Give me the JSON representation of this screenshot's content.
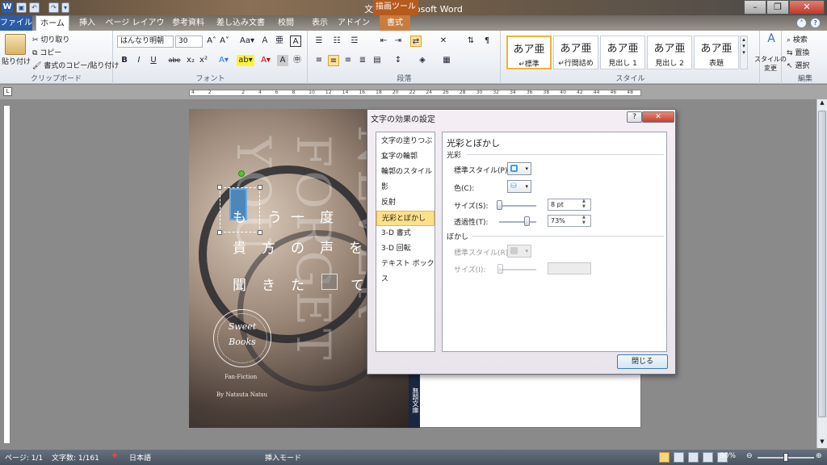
{
  "app": {
    "title": "文書1 - Microsoft Word",
    "context_tab": "描画ツール",
    "logo": "W"
  },
  "quick_access": [
    "save",
    "undo",
    "redo",
    "customize"
  ],
  "tabs": [
    {
      "label": "ファイル"
    },
    {
      "label": "ホーム"
    },
    {
      "label": "挿入"
    },
    {
      "label": "ページ レイアウト"
    },
    {
      "label": "参考資料"
    },
    {
      "label": "差し込み文書"
    },
    {
      "label": "校閲"
    },
    {
      "label": "表示"
    },
    {
      "label": "アドイン"
    },
    {
      "label": "書式"
    }
  ],
  "ribbon": {
    "clipboard": {
      "paste": "貼り付け",
      "cut": "切り取り",
      "copy": "コピー",
      "format_painter": "書式のコピー/貼り付け",
      "label": "クリップボード"
    },
    "font": {
      "name": "はんなり明朝",
      "size": "30",
      "label": "フォント",
      "buttons_row1": [
        "A˄",
        "A˅",
        "Aa▾",
        "Ａ",
        "亜",
        "A"
      ],
      "buttons_row2": [
        "B",
        "I",
        "U",
        "abe",
        "x₂",
        "x²",
        "A▾",
        "ab▾",
        "A▾",
        "A",
        "㊥"
      ]
    },
    "paragraph": {
      "label": "段落"
    },
    "styles": {
      "label": "スタイル",
      "items": [
        {
          "preview": "あア亜",
          "name": "↵標準"
        },
        {
          "preview": "あア亜",
          "name": "↵行間詰め"
        },
        {
          "preview": "あア亜",
          "name": "見出し 1"
        },
        {
          "preview": "あア亜",
          "name": "見出し 2"
        },
        {
          "preview": "あア亜",
          "name": "表題"
        }
      ],
      "change": "スタイルの 変更"
    },
    "editing": {
      "label": "編集",
      "find": "検索",
      "replace": "置換",
      "select": "選択"
    }
  },
  "ruler_numbers": [
    "4",
    "2",
    "",
    "2",
    "4",
    "6",
    "8",
    "10",
    "12",
    "14",
    "16",
    "18",
    "20",
    "22",
    "24",
    "26",
    "28",
    "30",
    "32",
    "34",
    "36",
    "38",
    "40",
    "42",
    "44",
    "46",
    "48"
  ],
  "document": {
    "cover_vertical_text": [
      "NEVER",
      "FORGET",
      "YOU"
    ],
    "line1": [
      "も",
      "う",
      "一",
      "度"
    ],
    "line2": [
      "貴",
      "方",
      "の",
      "声",
      "を"
    ],
    "line3": [
      "聞",
      "き",
      "た",
      "",
      "て"
    ],
    "seal_line1": "Sweet",
    "seal_line2": "Books",
    "fan_fiction": "Fan-Fiction",
    "author": "By Natsuta Natsu",
    "spine": "無題文庫"
  },
  "dialog": {
    "title": "文字の効果の設定",
    "help": "?",
    "close": "✕",
    "nav": [
      "文字の塗りつぶし",
      "文字の輪郭",
      "輪郭のスタイル",
      "影",
      "反射",
      "光彩とぼかし",
      "3-D 書式",
      "3-D 回転",
      "テキスト ボックス"
    ],
    "nav_selected": 5,
    "heading": "光彩とぼかし",
    "glow": {
      "label": "光彩",
      "preset_label": "標準スタイル(P):",
      "color_label": "色(C):",
      "size_label": "サイズ(S):",
      "size_value": "8 pt",
      "size_pct": 0.0,
      "transparency_label": "透過性(T):",
      "transparency_value": "73%",
      "transparency_pct": 0.73
    },
    "blur": {
      "label": "ぼかし",
      "preset_label": "標準スタイル(R):",
      "size_label": "サイズ(I):",
      "size_value": ""
    },
    "ok_button": "閉じる"
  },
  "status": {
    "page": "ページ: 1/1",
    "words": "文字数: 1/161",
    "language": "日本語",
    "mode": "挿入モード",
    "zoom": "90%",
    "zoom_pct": 0.9
  },
  "colors": {
    "accent": "#2a5ca8",
    "selected": "#fde18a",
    "glow": "#35a0e8"
  }
}
